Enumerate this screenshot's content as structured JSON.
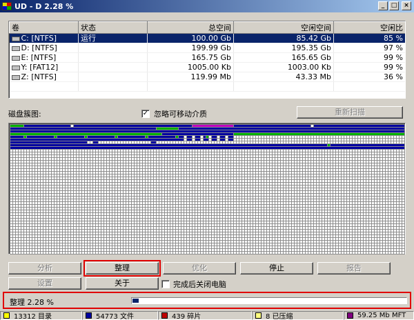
{
  "window": {
    "title": "UD - D   2.28 %"
  },
  "volumes": {
    "headers": [
      "卷",
      "状态",
      "总空间",
      "空闲空间",
      "空闲比"
    ],
    "rows": [
      {
        "volume": "C: [NTFS]",
        "status": "运行",
        "total": "100.00 Gb",
        "free": "85.42 Gb",
        "percent": "85 %",
        "selected": true
      },
      {
        "volume": "D: [NTFS]",
        "status": "",
        "total": "199.99 Gb",
        "free": "195.35 Gb",
        "percent": "97 %",
        "selected": false
      },
      {
        "volume": "E: [NTFS]",
        "status": "",
        "total": "165.75 Gb",
        "free": "165.65 Gb",
        "percent": "99 %",
        "selected": false
      },
      {
        "volume": "Y: [FAT12]",
        "status": "",
        "total": "1005.00 Kb",
        "free": "1003.00 Kb",
        "percent": "99 %",
        "selected": false
      },
      {
        "volume": "Z: [NTFS]",
        "status": "",
        "total": "119.99 Mb",
        "free": "43.33 Mb",
        "percent": "36 %",
        "selected": false
      }
    ]
  },
  "map": {
    "label": "磁盘簇图:",
    "ignore_removable": {
      "label": "忽略可移动介质",
      "checked": true
    },
    "rescan_label": "重新扫描",
    "colors": {
      "free": "#ffffff",
      "used": "#0000a0",
      "fragmented": "#00b000",
      "mft": "#c000c0",
      "grid": "#8c8c8c"
    }
  },
  "buttons": {
    "analyze": "分析",
    "defrag": "整理",
    "optimize": "优化",
    "stop": "停止",
    "report": "报告",
    "settings": "设置",
    "about": "关于"
  },
  "shutdown": {
    "label": "完成后关闭电脑",
    "checked": false
  },
  "status": {
    "text": "整理   2.28 %",
    "progress": 0.0228
  },
  "legend": [
    {
      "label": "13312 目录",
      "color": "#ffff00"
    },
    {
      "label": "54773 文件",
      "color": "#0000a0"
    },
    {
      "label": "439 碎片",
      "color": "#c00000"
    },
    {
      "label": "8 已压缩",
      "color": "#ffff80"
    },
    {
      "label": "59.25 Mb MFT",
      "color": "#800080"
    }
  ]
}
